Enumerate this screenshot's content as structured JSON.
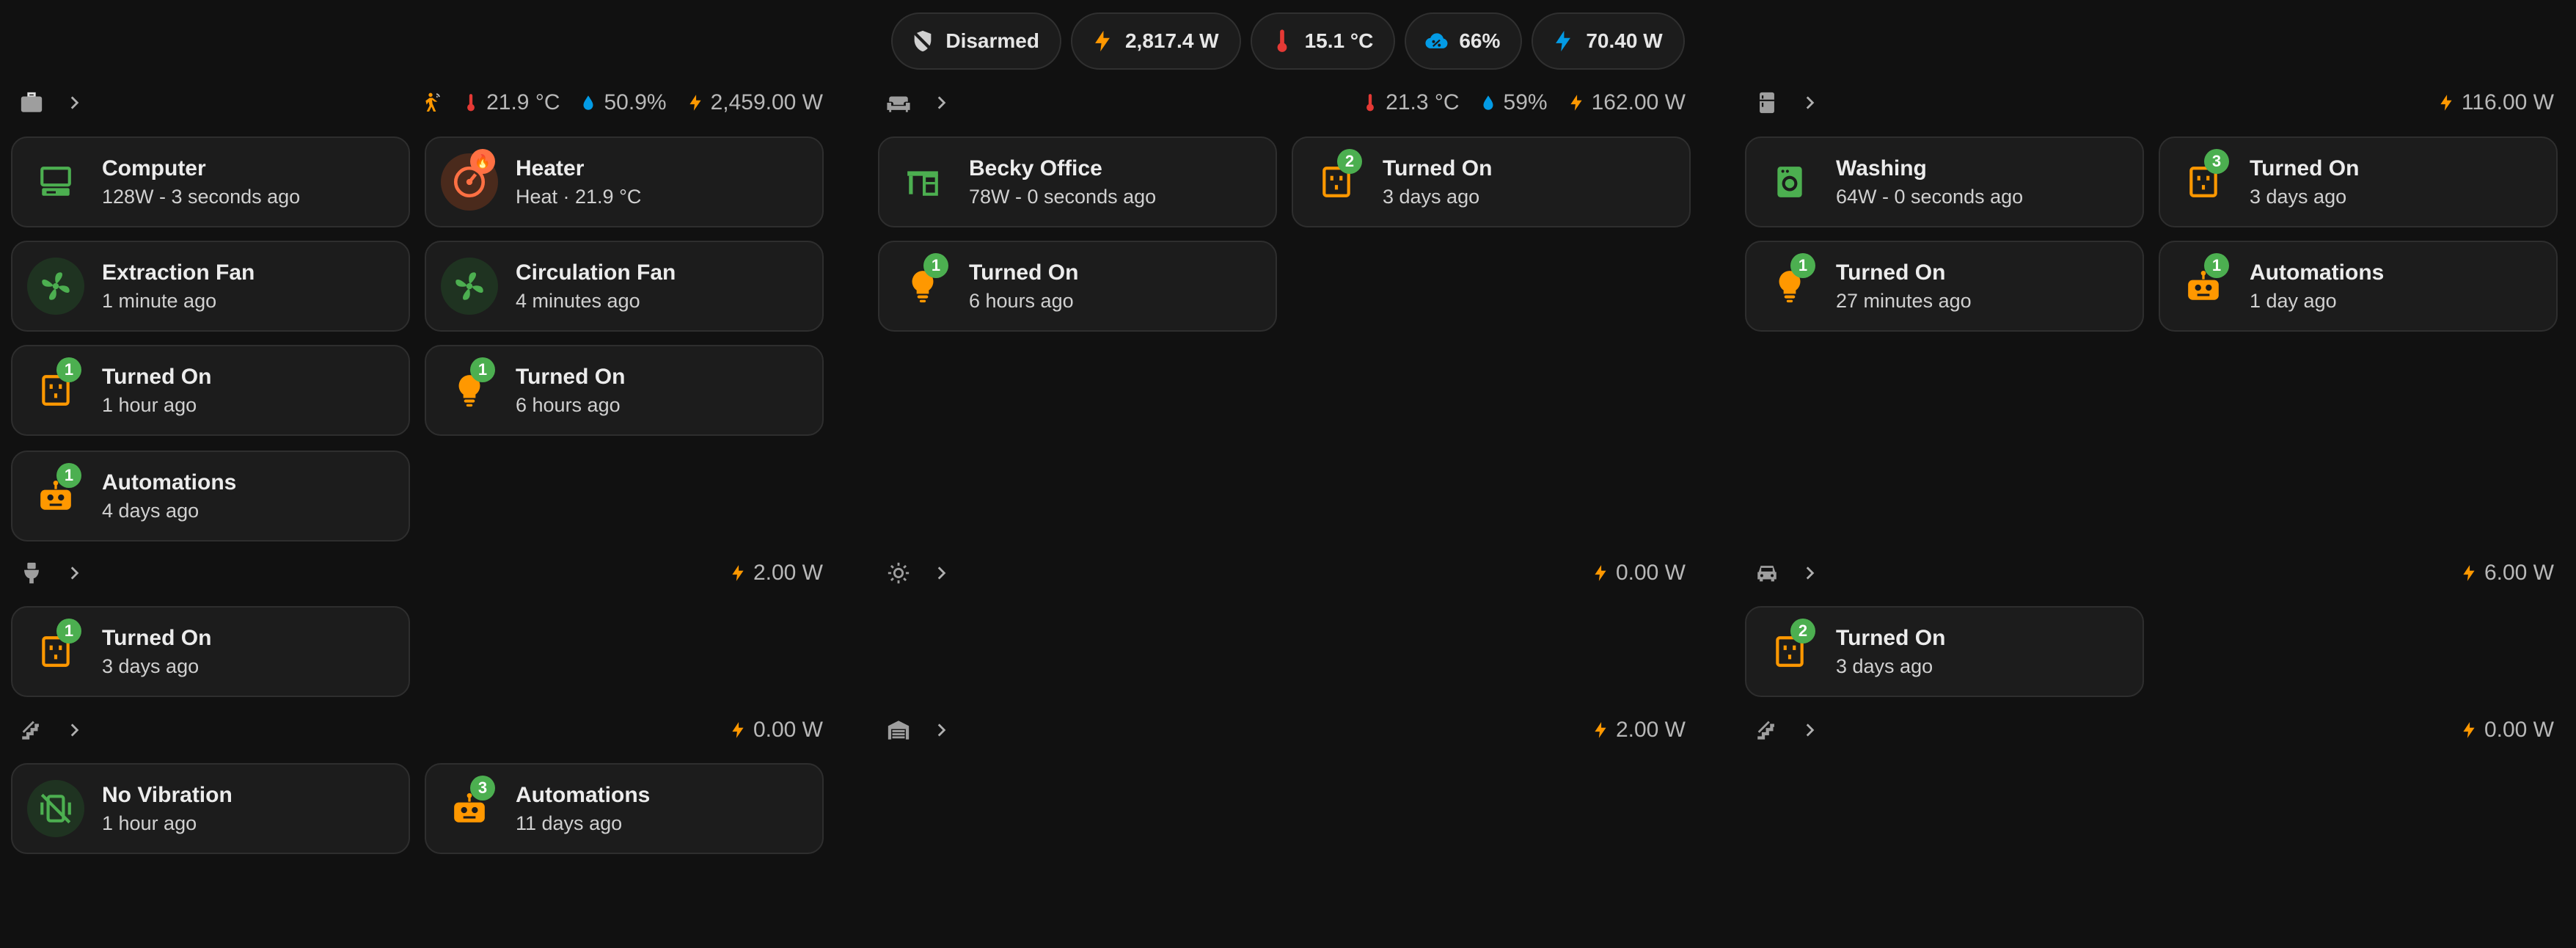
{
  "colors": {
    "accent_orange": "#ff9800",
    "accent_green": "#4caf50",
    "accent_blue": "#039be5",
    "accent_red": "#e53935",
    "bg": "#111111",
    "tile": "#1c1c1c"
  },
  "header_badges": [
    {
      "icon": "shield-off-icon",
      "label": "Disarmed"
    },
    {
      "icon": "lightning-icon",
      "label": "2,817.4 W"
    },
    {
      "icon": "thermometer-icon",
      "label": "15.1 °C"
    },
    {
      "icon": "cloud-percent-icon",
      "label": "66%"
    },
    {
      "icon": "lightning-icon",
      "label": "70.40 W"
    }
  ],
  "areas": {
    "work": {
      "icon": "briefcase-icon",
      "sensors": {
        "temperature": "21.9 °C",
        "humidity": "50.9%",
        "power": "2,459.00 W"
      },
      "tiles": [
        {
          "icon": "desktop-icon",
          "title": "Computer",
          "subtitle": "128W - 3 seconds ago"
        },
        {
          "icon": "radiator-icon",
          "title": "Heater",
          "subtitle": "Heat · 21.9 °C"
        },
        {
          "icon": "fan-icon",
          "title": "Extraction Fan",
          "subtitle": "1 minute ago"
        },
        {
          "icon": "fan-icon",
          "title": "Circulation Fan",
          "subtitle": "4 minutes ago"
        },
        {
          "icon": "power-socket-icon",
          "title": "Turned On",
          "subtitle": "1 hour ago",
          "count": "1"
        },
        {
          "icon": "lightbulb-icon",
          "title": "Turned On",
          "subtitle": "6 hours ago",
          "count": "1"
        },
        {
          "icon": "robot-icon",
          "title": "Automations",
          "subtitle": "4 days ago",
          "count": "1"
        }
      ]
    },
    "office": {
      "icon": "sofa-icon",
      "sensors": {
        "temperature": "21.3 °C",
        "humidity": "59%",
        "power": "162.00 W"
      },
      "tiles": [
        {
          "icon": "desk-icon",
          "title": "Becky Office",
          "subtitle": "78W - 0 seconds ago"
        },
        {
          "icon": "power-socket-icon",
          "title": "Turned On",
          "subtitle": "3 days ago",
          "count": "2"
        },
        {
          "icon": "lightbulb-icon",
          "title": "Turned On",
          "subtitle": "6 hours ago",
          "count": "1"
        }
      ]
    },
    "utility": {
      "icon": "fridge-icon",
      "sensors": {
        "power": "116.00 W"
      },
      "tiles": [
        {
          "icon": "washing-machine-icon",
          "title": "Washing",
          "subtitle": "64W - 0 seconds ago"
        },
        {
          "icon": "power-socket-icon",
          "title": "Turned On",
          "subtitle": "3 days ago",
          "count": "3"
        },
        {
          "icon": "lightbulb-icon",
          "title": "Turned On",
          "subtitle": "27 minutes ago",
          "count": "1"
        },
        {
          "icon": "robot-icon",
          "title": "Automations",
          "subtitle": "1 day ago",
          "count": "1"
        }
      ]
    },
    "toilet": {
      "icon": "toilet-icon",
      "sensors": {
        "power": "2.00 W"
      },
      "tiles": [
        {
          "icon": "power-socket-icon",
          "title": "Turned On",
          "subtitle": "3 days ago",
          "count": "1"
        }
      ]
    },
    "outside": {
      "icon": "sun-icon",
      "sensors": {
        "power": "0.00 W"
      }
    },
    "garage": {
      "icon": "car-icon",
      "sensors": {
        "power": "6.00 W"
      },
      "tiles": [
        {
          "icon": "power-socket-icon",
          "title": "Turned On",
          "subtitle": "3 days ago",
          "count": "2"
        }
      ]
    },
    "stairs": {
      "icon": "stairs-icon",
      "sensors": {
        "power": "0.00 W"
      },
      "tiles": [
        {
          "icon": "vibrate-off-icon",
          "title": "No Vibration",
          "subtitle": "1 hour ago"
        },
        {
          "icon": "robot-icon",
          "title": "Automations",
          "subtitle": "11 days ago",
          "count": "3"
        }
      ]
    },
    "shed": {
      "icon": "garage-icon",
      "sensors": {
        "power": "2.00 W"
      }
    },
    "landing": {
      "icon": "stairs-icon",
      "sensors": {
        "power": "0.00 W"
      }
    }
  }
}
